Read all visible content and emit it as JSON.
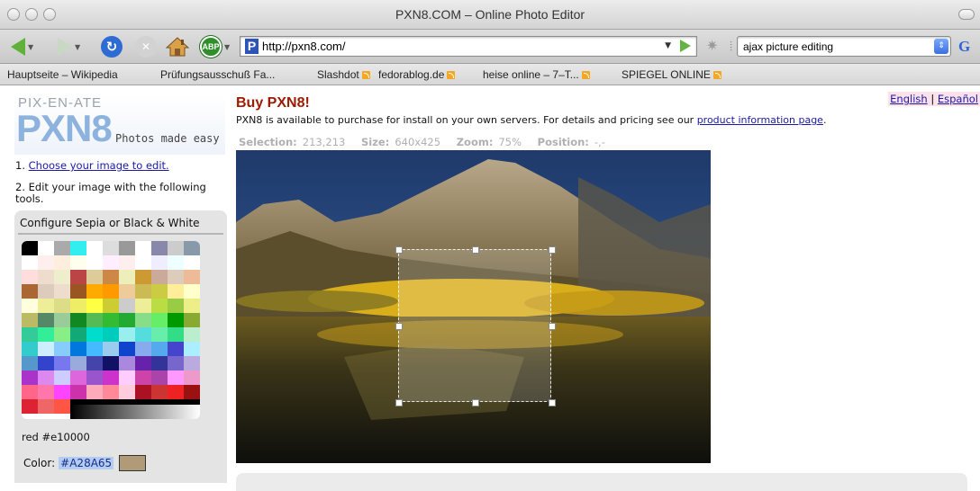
{
  "window": {
    "title": "PXN8.COM – Online Photo Editor"
  },
  "toolbar": {
    "url": "http://pxn8.com/",
    "search_value": "ajax picture editing",
    "abp_label": "ABP"
  },
  "bookmarks": [
    {
      "label": "Hauptseite – Wikipedia",
      "rss": false
    },
    {
      "label": "Prüfungsausschuß Fa...",
      "rss": false
    },
    {
      "label": "Slashdot",
      "rss": true
    },
    {
      "label": "fedorablog.de",
      "rss": true
    },
    {
      "label": "heise online – 7–T...",
      "rss": true
    },
    {
      "label": "SPIEGEL ONLINE",
      "rss": true
    }
  ],
  "logo": {
    "small": "PIX-EN-ATE",
    "big": "PXN8",
    "tagline": "Photos made easy"
  },
  "steps": {
    "step1_prefix": "1. ",
    "step1_link": "Choose your image to edit.",
    "step2": "2. Edit your image with the following tools."
  },
  "tool_panel": {
    "title": "Configure Sepia or Black & White",
    "selected_color_name": "red #e10000",
    "color_label": "Color:",
    "color_value": "#A28A65",
    "swatch_color": "#b09a78"
  },
  "main": {
    "buy_title": "Buy PXN8!",
    "buy_text_prefix": "PXN8 is available to purchase for install on your own servers. For details and pricing see our ",
    "buy_link": "product information page",
    "buy_text_suffix": ".",
    "lang_english": "English",
    "lang_sep": " | ",
    "lang_espanol": "Español"
  },
  "status": {
    "selection_label": "Selection:",
    "selection_value": "213,213",
    "size_label": "Size:",
    "size_value": "640x425",
    "zoom_label": "Zoom:",
    "zoom_value": "75%",
    "position_label": "Position:",
    "position_value": "-,-"
  }
}
